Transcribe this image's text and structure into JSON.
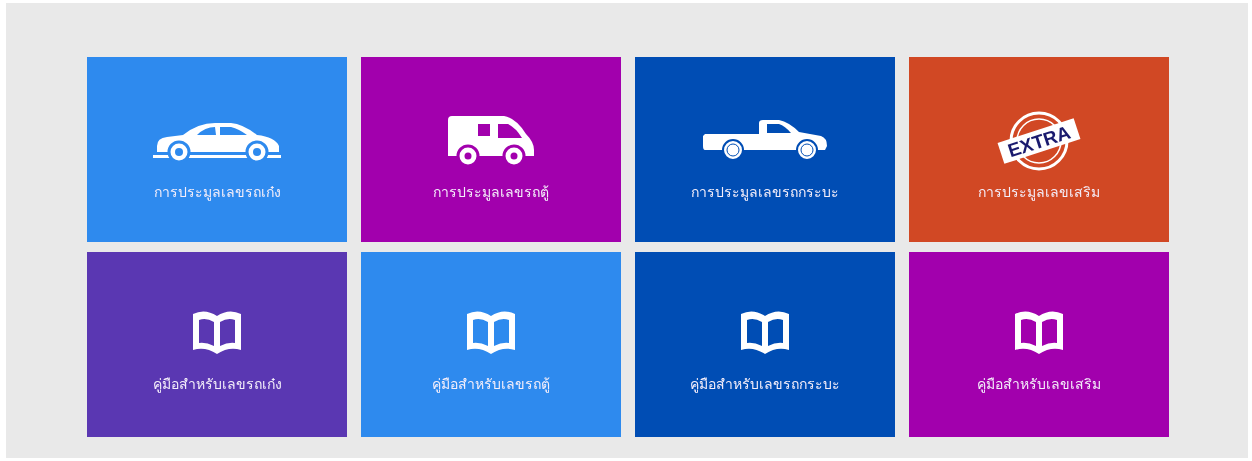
{
  "tiles": [
    {
      "kind": "car",
      "label": "การประมูลเลขรถเก๋ง",
      "color": "#2e8aee"
    },
    {
      "kind": "van",
      "label": "การประมูลเลขรถตู้",
      "color": "#a200ad"
    },
    {
      "kind": "pickup",
      "label": "การประมูลเลขรถกระบะ",
      "color": "#004db4"
    },
    {
      "kind": "extra",
      "label": "การประมูลเลขเสริม",
      "color": "#d14824",
      "badge_text": "EXTRA"
    },
    {
      "kind": "book",
      "label": "คู่มือสำหรับเลขรถเก๋ง",
      "color": "#5a37b2"
    },
    {
      "kind": "book",
      "label": "คู่มือสำหรับเลขรถตู้",
      "color": "#2e8aee"
    },
    {
      "kind": "book",
      "label": "คู่มือสำหรับเลขรถกระบะ",
      "color": "#004db4"
    },
    {
      "kind": "book",
      "label": "คู่มือสำหรับเลขเสริม",
      "color": "#a200ad"
    }
  ]
}
